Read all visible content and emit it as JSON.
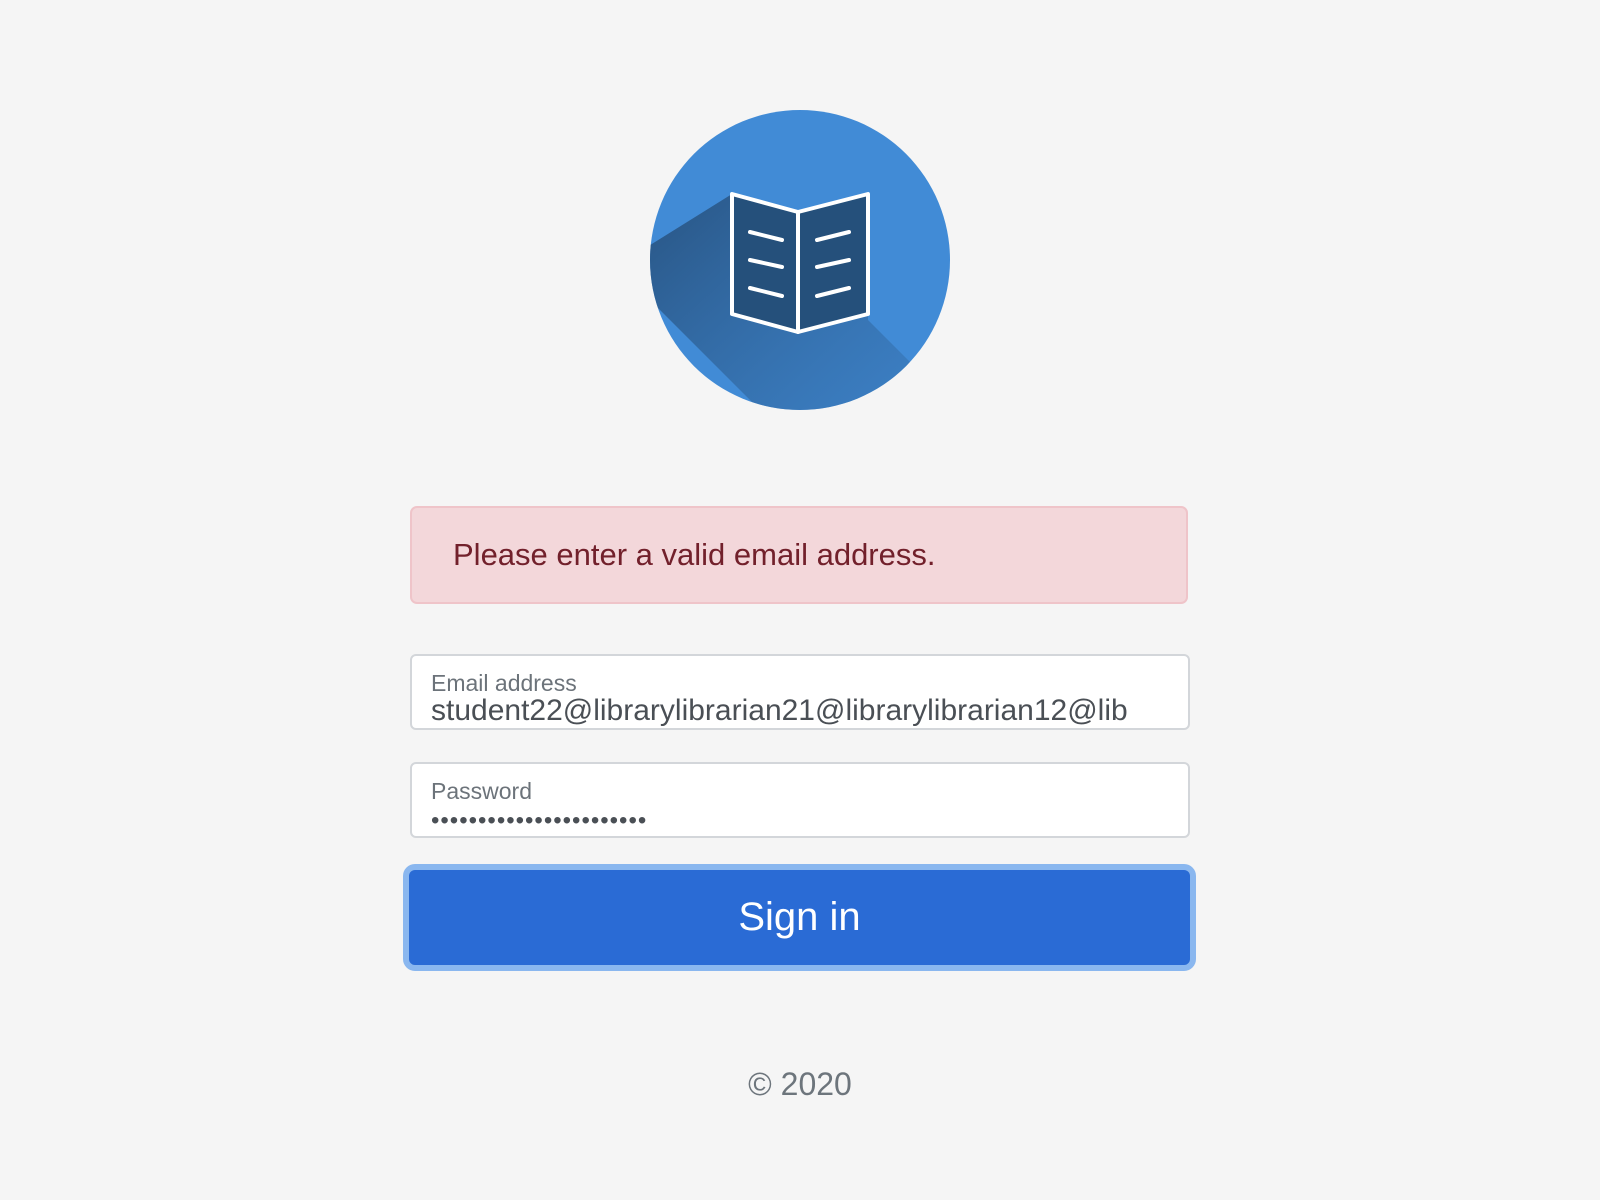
{
  "logo": {
    "icon": "open-book-icon",
    "circle_color": "#418bd6",
    "shadow_color": "#25507b"
  },
  "alert": {
    "message": "Please enter a valid email address.",
    "background": "#f3d7da",
    "text_color": "#72202b"
  },
  "email": {
    "label": "Email address",
    "value": "student22@librarylibrarian21@librarylibrarian12@lib"
  },
  "password": {
    "label": "Password",
    "value": "•••••••••••••••••••••••"
  },
  "signin": {
    "label": "Sign in",
    "color": "#2a6bd5"
  },
  "footer": {
    "text": "© 2020"
  }
}
